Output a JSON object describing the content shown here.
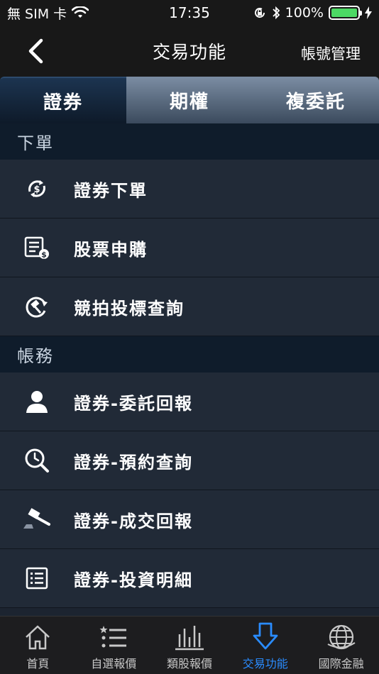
{
  "status_bar": {
    "carrier": "無 SIM 卡",
    "time": "17:35",
    "battery": "100%"
  },
  "nav": {
    "title": "交易功能",
    "right_action": "帳號管理"
  },
  "tabs": [
    {
      "label": "證券",
      "active": true
    },
    {
      "label": "期權",
      "active": false
    },
    {
      "label": "複委託",
      "active": false
    }
  ],
  "sections": [
    {
      "title": "下單",
      "items": [
        {
          "label": "證券下單",
          "icon": "dollar-refresh-icon"
        },
        {
          "label": "股票申購",
          "icon": "document-dollar-icon"
        },
        {
          "label": "競拍投標查詢",
          "icon": "gavel-circle-icon"
        }
      ]
    },
    {
      "title": "帳務",
      "items": [
        {
          "label": "證券-委託回報",
          "icon": "person-icon"
        },
        {
          "label": "證券-預約查詢",
          "icon": "clock-search-icon"
        },
        {
          "label": "證券-成交回報",
          "icon": "gavel-icon"
        },
        {
          "label": "證券-投資明細",
          "icon": "list-document-icon"
        }
      ]
    }
  ],
  "tab_bar": [
    {
      "label": "首頁",
      "icon": "home-icon",
      "active": false
    },
    {
      "label": "自選報價",
      "icon": "star-list-icon",
      "active": false
    },
    {
      "label": "類股報價",
      "icon": "bar-chart-icon",
      "active": false
    },
    {
      "label": "交易功能",
      "icon": "down-arrow-icon",
      "active": true
    },
    {
      "label": "國際金融",
      "icon": "globe-icon",
      "active": false
    }
  ],
  "colors": {
    "accent": "#2a8cff",
    "battery": "#4cd964",
    "section_bg": "#0f1c2b",
    "item_bg": "#212a37"
  }
}
